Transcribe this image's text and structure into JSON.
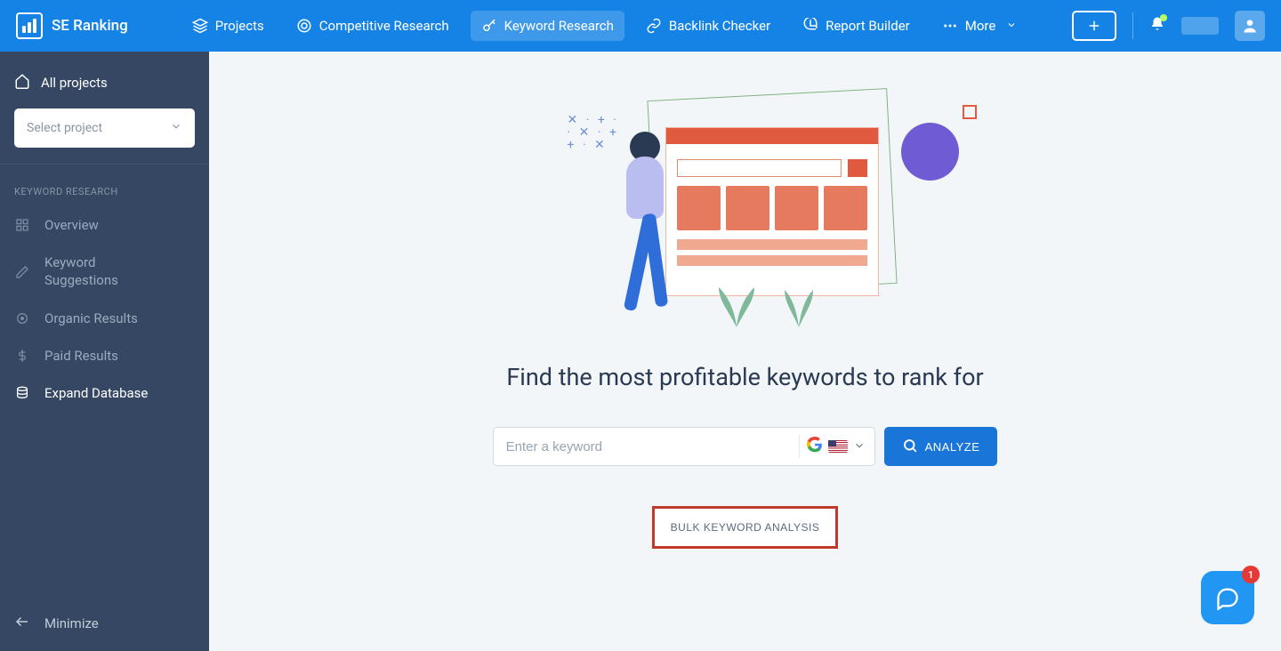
{
  "brand": "SE Ranking",
  "topnav": {
    "projects": "Projects",
    "competitive": "Competitive Research",
    "keyword": "Keyword Research",
    "backlink": "Backlink Checker",
    "report": "Report Builder",
    "more": "More"
  },
  "sidebar": {
    "all_projects": "All projects",
    "select_project": "Select project",
    "section_title": "KEYWORD RESEARCH",
    "items": {
      "overview": "Overview",
      "suggestions": "Keyword Suggestions",
      "organic": "Organic Results",
      "paid": "Paid Results",
      "expand": "Expand Database"
    },
    "minimize": "Minimize"
  },
  "main": {
    "headline": "Find the most profitable keywords to rank for",
    "keyword_placeholder": "Enter a keyword",
    "analyze": "ANALYZE",
    "bulk": "BULK KEYWORD ANALYSIS"
  },
  "chat": {
    "badge": "1"
  }
}
